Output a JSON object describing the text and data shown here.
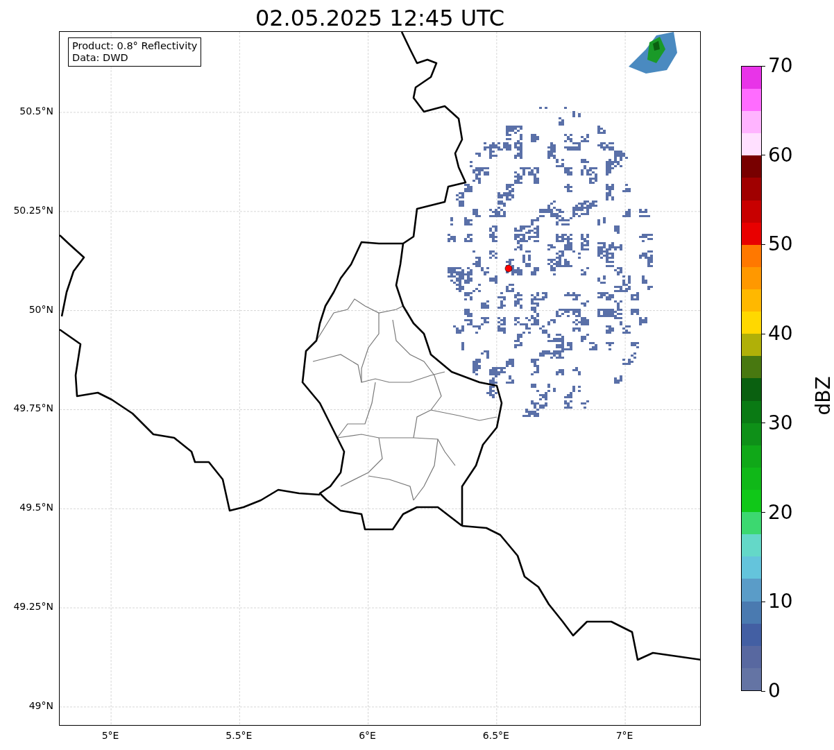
{
  "title": "02.05.2025 12:45 UTC",
  "info_box": {
    "lines": [
      "Product: 0.8° Reflectivity",
      "Data: DWD"
    ]
  },
  "map": {
    "yticks": [
      "50.5°N",
      "50.25°N",
      "50°N",
      "49.75°N",
      "49.5°N",
      "49.25°N",
      "49°N"
    ],
    "xticks": [
      "5°E",
      "5.5°E",
      "6°E",
      "6.5°E",
      "7°E"
    ]
  },
  "colorbar": {
    "label": "dBZ",
    "ticks": [
      "70",
      "60",
      "50",
      "40",
      "30",
      "20",
      "10",
      "0"
    ],
    "segments": [
      {
        "color": "#6474a4"
      },
      {
        "color": "#5868a0"
      },
      {
        "color": "#435fa3"
      },
      {
        "color": "#4a7ab0"
      },
      {
        "color": "#5a9cc8"
      },
      {
        "color": "#64c4dc"
      },
      {
        "color": "#64d8c8"
      },
      {
        "color": "#3cd870"
      },
      {
        "color": "#10c818"
      },
      {
        "color": "#10b818"
      },
      {
        "color": "#10a818"
      },
      {
        "color": "#0e9018"
      },
      {
        "color": "#0a7a14"
      },
      {
        "color": "#0a6010"
      },
      {
        "color": "#487810"
      },
      {
        "color": "#b0b008"
      },
      {
        "color": "#ffd800"
      },
      {
        "color": "#ffb800"
      },
      {
        "color": "#ff9800"
      },
      {
        "color": "#ff7800"
      },
      {
        "color": "#e80000"
      },
      {
        "color": "#c80000"
      },
      {
        "color": "#a00000"
      },
      {
        "color": "#780000"
      },
      {
        "color": "#ffe0ff"
      },
      {
        "color": "#ffb4ff"
      },
      {
        "color": "#ff6cff"
      },
      {
        "color": "#e834e8"
      }
    ]
  }
}
